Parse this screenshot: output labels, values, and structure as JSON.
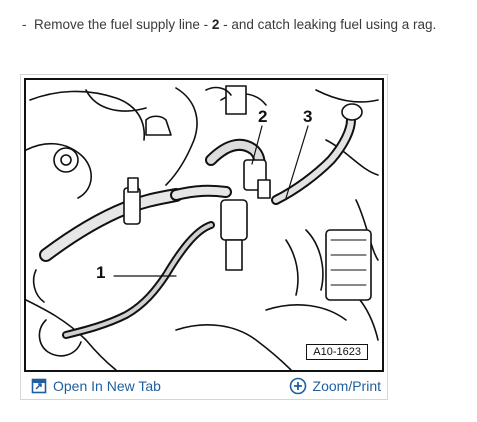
{
  "instruction": {
    "bullet": "-",
    "before": "Remove the fuel supply line - ",
    "number": "2",
    "after": " - and catch leaking fuel using a rag."
  },
  "figure": {
    "callouts": [
      "1",
      "2",
      "3"
    ],
    "figure_id": "A10-1623"
  },
  "toolbar": {
    "open_tab_label": "Open In New Tab",
    "zoom_label": "Zoom/Print",
    "open_tab_icon": "open-in-new-tab-icon",
    "zoom_icon": "plus-circle-icon",
    "link_color": "#1f5f9f"
  }
}
